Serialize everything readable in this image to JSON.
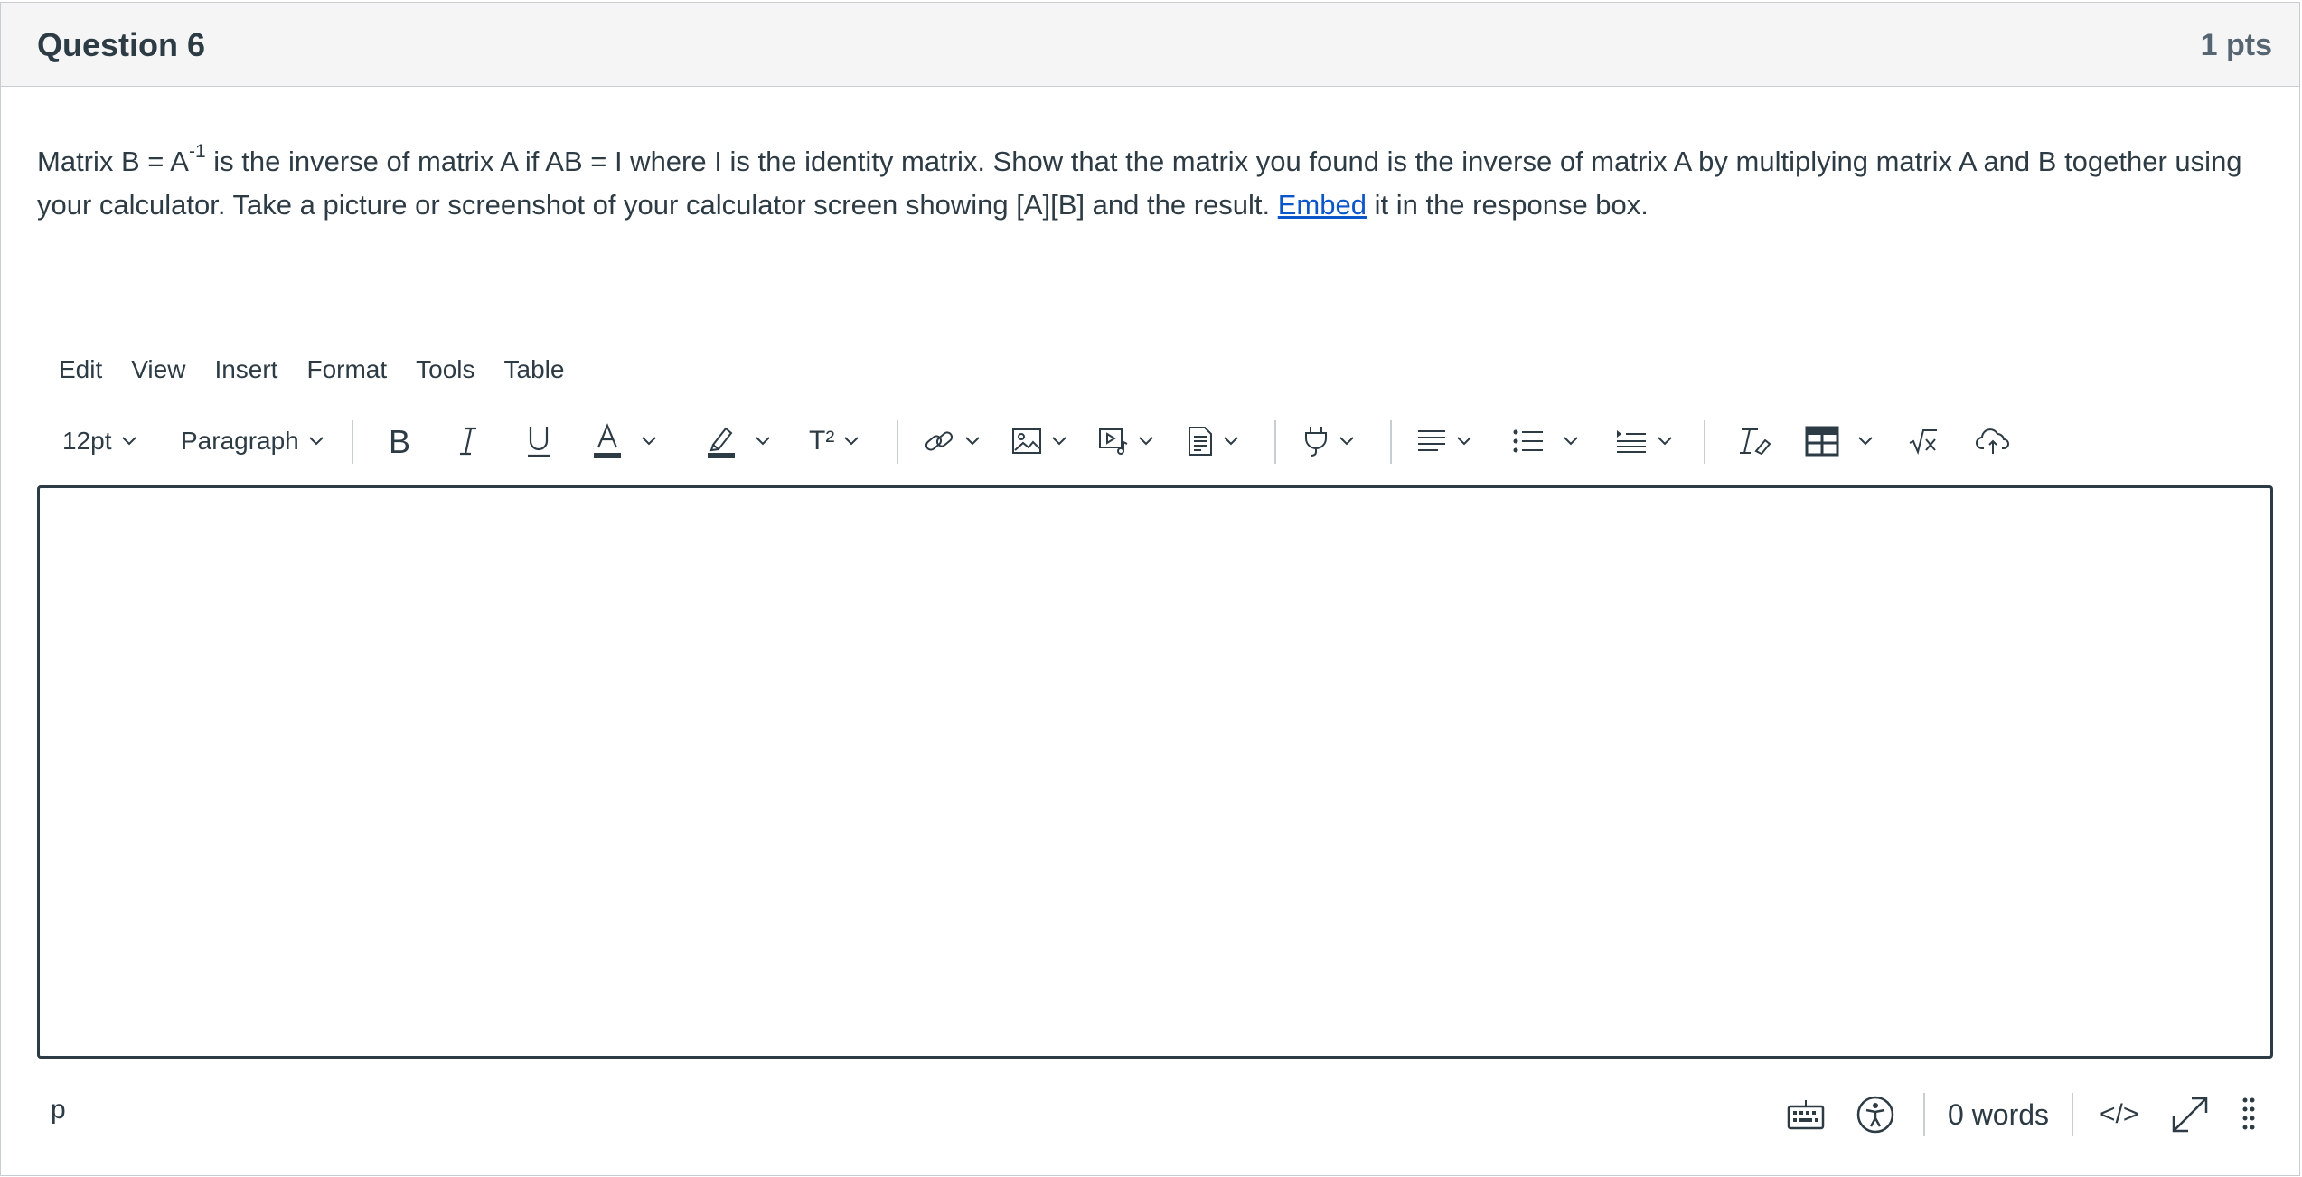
{
  "question": {
    "title": "Question 6",
    "points": "1 pts",
    "text_part1": "Matrix B = A",
    "text_superscript": "-1",
    "text_part2": " is the inverse of matrix A if AB = I where I is the identity matrix. Show that the matrix you found is the inverse of matrix A by multiplying matrix A and B together using your calculator. Take a picture or screenshot of your calculator screen showing [A][B] and the result. ",
    "link_text": "Embed",
    "text_part3": " it in the response box."
  },
  "menubar": {
    "edit": "Edit",
    "view": "View",
    "insert": "Insert",
    "format": "Format",
    "tools": "Tools",
    "table": "Table"
  },
  "toolbar": {
    "font_size": "12pt",
    "block_format": "Paragraph",
    "superscript_label": "T²",
    "icons": [
      "bold-icon",
      "italic-icon",
      "underline-icon",
      "text-color-icon",
      "highlight-icon",
      "superscript-icon",
      "link-icon",
      "image-icon",
      "media-icon",
      "document-icon",
      "plugin-icon",
      "align-icon",
      "bullet-list-icon",
      "indent-icon",
      "clear-format-icon",
      "table-icon",
      "equation-icon",
      "upload-cloud-icon"
    ]
  },
  "editor": {
    "content": ""
  },
  "statusbar": {
    "element_path": "p",
    "word_count": "0 words",
    "html_toggle": "</>"
  },
  "colors": {
    "text": "#2d3b45",
    "link": "#0b56c9",
    "header_bg": "#f5f5f5",
    "border": "#c7cdd1"
  }
}
